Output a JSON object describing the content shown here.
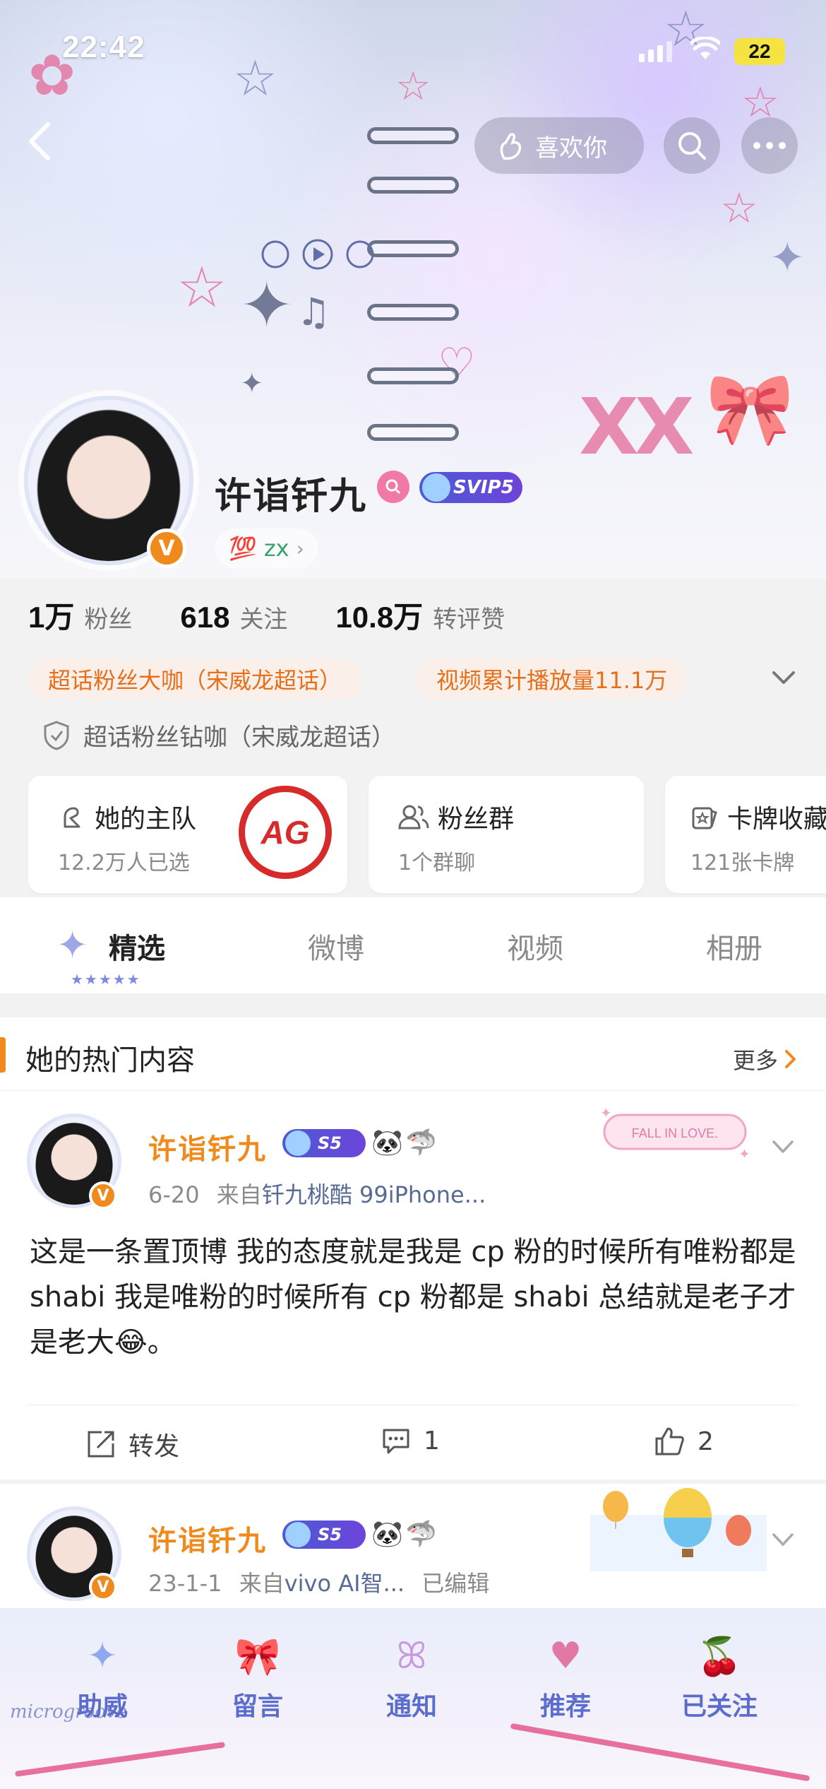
{
  "status_bar": {
    "time": "22:42",
    "battery": "22"
  },
  "header": {
    "like_label": "喜欢你"
  },
  "profile": {
    "name": "许诣钎九",
    "svip": "SVIP5",
    "tag_text": "zx",
    "tag_prefix": "💯",
    "stats": [
      {
        "value": "1万",
        "label": "粉丝"
      },
      {
        "value": "618",
        "label": "关注"
      },
      {
        "value": "10.8万",
        "label": "转评赞"
      }
    ],
    "honors": [
      "超话粉丝大咖（宋威龙超话）",
      "视频累计播放量11.1万"
    ],
    "honor_secondary": "超话粉丝钻咖（宋威龙超话）"
  },
  "cards": [
    {
      "title": "她的主队",
      "sub": "12.2万人已选",
      "logo": "AG"
    },
    {
      "title": "粉丝群",
      "sub": "1个群聊"
    },
    {
      "title": "卡牌收藏",
      "sub": "121张卡牌"
    }
  ],
  "tabs": [
    "精选",
    "微博",
    "视频",
    "相册"
  ],
  "hot_section": {
    "title": "她的热门内容",
    "more": "更多"
  },
  "posts": [
    {
      "name": "许诣钎九",
      "level": "S5",
      "date": "6-20",
      "source_prefix": "来自",
      "source": "钎九桃酷 99iPhone...",
      "sticker_text": "FALL IN LOVE.",
      "body": "这是一条置顶博 我的态度就是我是 cp 粉的时候所有唯粉都是 shabi 我是唯粉的时候所有 cp 粉都是 shabi 总结就是老子才是老大😂。",
      "repost": "转发",
      "comments": "1",
      "likes": "2"
    },
    {
      "name": "许诣钎九",
      "level": "S5",
      "date": "23-1-1",
      "source_prefix": "来自",
      "source": "vivo AI智...",
      "edited": "已编辑"
    }
  ],
  "bottom_bar": [
    "助威",
    "留言",
    "通知",
    "推荐",
    "已关注"
  ],
  "watermark": "microgroove"
}
